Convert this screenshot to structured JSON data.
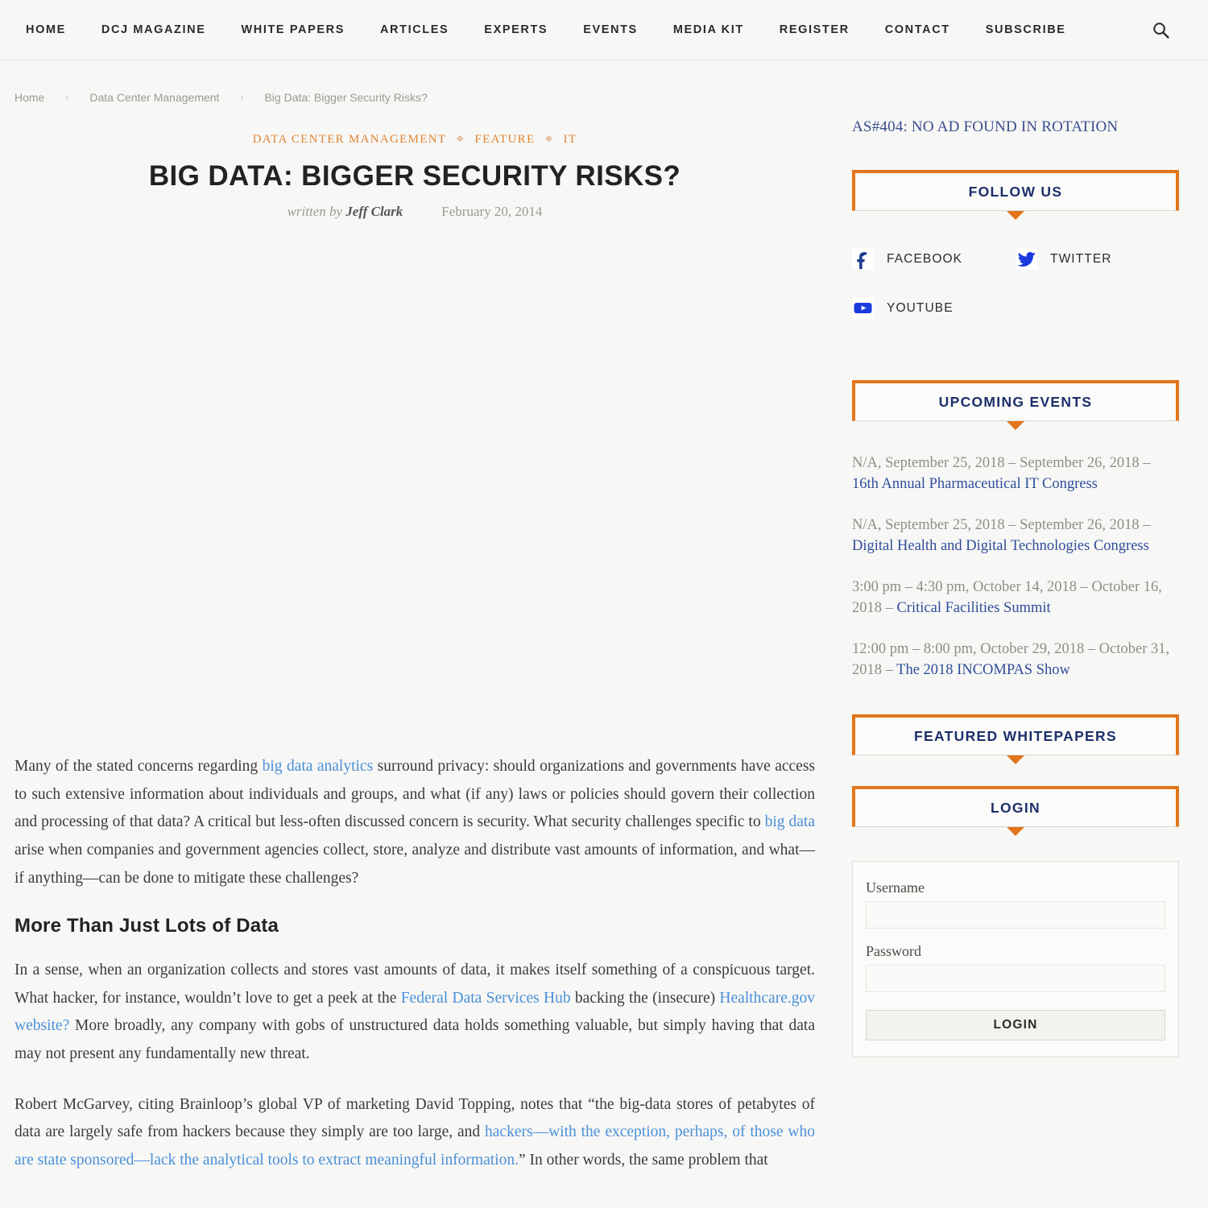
{
  "nav": {
    "items": [
      {
        "label": "HOME",
        "name": "nav-home"
      },
      {
        "label": "DCJ MAGAZINE",
        "name": "nav-dcj-magazine"
      },
      {
        "label": "WHITE PAPERS",
        "name": "nav-white-papers"
      },
      {
        "label": "ARTICLES",
        "name": "nav-articles"
      },
      {
        "label": "EXPERTS",
        "name": "nav-experts"
      },
      {
        "label": "EVENTS",
        "name": "nav-events"
      },
      {
        "label": "MEDIA KIT",
        "name": "nav-media-kit"
      },
      {
        "label": "REGISTER",
        "name": "nav-register"
      },
      {
        "label": "CONTACT",
        "name": "nav-contact"
      },
      {
        "label": "SUBSCRIBE",
        "name": "nav-subscribe"
      }
    ],
    "search_icon": "search-icon"
  },
  "breadcrumb": {
    "items": [
      "Home",
      "Data Center Management",
      "Big Data: Bigger Security Risks?"
    ],
    "separator": "›"
  },
  "article": {
    "categories": [
      "DATA CENTER MANAGEMENT",
      "FEATURE",
      "IT"
    ],
    "category_separator": "❖",
    "title": "BIG DATA: BIGGER SECURITY RISKS?",
    "written_by_label": "written by",
    "author": "Jeff Clark",
    "date": "February 20, 2014",
    "paragraphs": [
      {
        "type": "p",
        "parts": [
          {
            "t": "Many of the stated concerns regarding "
          },
          {
            "t": "big data analytics",
            "link": true
          },
          {
            "t": " surround privacy: should organizations and governments have access to such extensive information about individuals and groups, and what (if any) laws or policies should govern their collection and processing of that data? A critical but less-often discussed concern is security. What security challenges specific to "
          },
          {
            "t": "big data",
            "link": true
          },
          {
            "t": " arise when companies and government agencies collect, store, analyze and distribute vast amounts of information, and what—if anything—can be done to mitigate these challenges?"
          }
        ]
      },
      {
        "type": "h2",
        "text": "More Than Just Lots of Data"
      },
      {
        "type": "p",
        "parts": [
          {
            "t": "In a sense, when an organization collects and stores vast amounts of data, it makes itself something of a conspicuous target. What hacker, for instance, wouldn’t love to get a peek at the "
          },
          {
            "t": "Federal Data Services Hub",
            "link": true
          },
          {
            "t": " backing the (insecure) "
          },
          {
            "t": "Healthcare.gov website?",
            "link": true
          },
          {
            "t": " More broadly, any company with gobs of unstructured data holds something valuable, but simply having that data may not present any fundamentally new threat."
          }
        ]
      },
      {
        "type": "p",
        "parts": [
          {
            "t": "Robert McGarvey, citing Brainloop’s global VP of marketing David Topping, notes that “the big-data stores of petabytes of data are largely safe from hackers because they simply are too large, and "
          },
          {
            "t": "hackers—with the exception, perhaps, of those who are state sponsored—lack the analytical tools to extract meaningful information.",
            "link": true
          },
          {
            "t": "” In other words, the same problem that"
          }
        ]
      }
    ]
  },
  "sidebar": {
    "ad_notice": "AS#404: NO AD FOUND IN ROTATION",
    "follow_us": {
      "title": "FOLLOW US",
      "socials": [
        {
          "label": "FACEBOOK",
          "icon": "facebook-icon"
        },
        {
          "label": "TWITTER",
          "icon": "twitter-icon"
        },
        {
          "label": "YOUTUBE",
          "icon": "youtube-icon"
        }
      ]
    },
    "upcoming_events": {
      "title": "UPCOMING EVENTS",
      "events": [
        {
          "prefix": "N/A, September 25, 2018 – September 26, 2018 – ",
          "link": "16th Annual Pharmaceutical IT Congress",
          "suffix": ""
        },
        {
          "prefix": "N/A, September 25, 2018 – September 26, 2018 – ",
          "link": "Digital Health and Digital Technologies Congress",
          "suffix": ""
        },
        {
          "prefix": "3:00 pm – 4:30 pm, October 14, 2018 – October 16, 2018 – ",
          "link": "Critical Facilities Summit",
          "suffix": ""
        },
        {
          "prefix": "12:00 pm – 8:00 pm, October 29, 2018 – October 31, 2018 – ",
          "link": "The 2018 INCOMPAS Show",
          "suffix": ""
        }
      ]
    },
    "featured_whitepapers": {
      "title": "FEATURED WHITEPAPERS"
    },
    "login": {
      "title": "LOGIN",
      "username_label": "Username",
      "username_value": "",
      "password_label": "Password",
      "password_value": "",
      "button_label": "LOGIN"
    }
  },
  "colors": {
    "accent_orange": "#e2751b",
    "heading_blue": "#1c2f6b",
    "link_blue": "#4a90d9",
    "event_link_blue": "#2f4d9b",
    "category_orange": "#e08432",
    "page_bg": "#f7f7f5"
  }
}
